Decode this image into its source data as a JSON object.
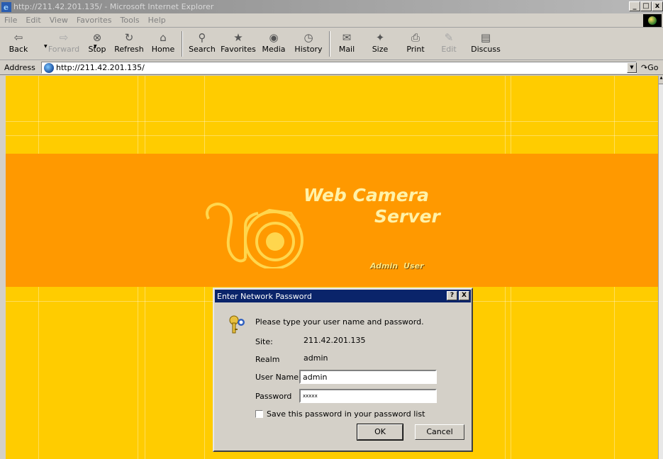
{
  "window": {
    "title": "http://211.42.201.135/ - Microsoft Internet Explorer",
    "min": "_",
    "max": "□",
    "close": "x"
  },
  "menu": {
    "file": "File",
    "edit": "Edit",
    "view": "View",
    "favorites": "Favorites",
    "tools": "Tools",
    "help": "Help"
  },
  "toolbar": {
    "back": "Back",
    "forward": "Forward",
    "stop": "Stop",
    "refresh": "Refresh",
    "home": "Home",
    "search": "Search",
    "favorites": "Favorites",
    "media": "Media",
    "history": "History",
    "mail": "Mail",
    "size": "Size",
    "print": "Print",
    "edit": "Edit",
    "discuss": "Discuss"
  },
  "address": {
    "label": "Address",
    "url": "http://211.42.201.135/",
    "go": "Go"
  },
  "page": {
    "title_line1": "Web Camera",
    "title_line2": "Server",
    "nav_admin": "Admin",
    "nav_user": "User",
    "bg_color": "#ffcc00",
    "banner_color": "#ff9900"
  },
  "dialog": {
    "title": "Enter Network Password",
    "help_btn": "?",
    "close_btn": "X",
    "prompt": "Please type your user name and password.",
    "site_label": "Site:",
    "site_value": "211.42.201.135",
    "realm_label": "Realm",
    "realm_value": "admin",
    "username_label": "User Name",
    "username_value": "admin",
    "password_label": "Password",
    "password_value": "xxxxx",
    "save_label": "Save this password in your password list",
    "save_checked": false,
    "ok": "OK",
    "cancel": "Cancel"
  }
}
